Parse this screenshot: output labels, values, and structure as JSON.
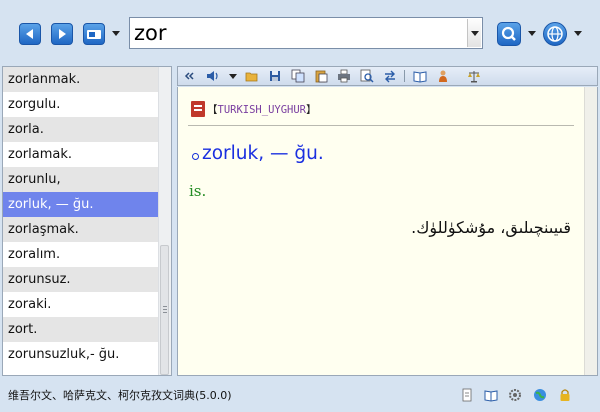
{
  "search": {
    "value": "zor"
  },
  "wordlist": {
    "items": [
      {
        "label": "zorlanmak.",
        "state": "shade"
      },
      {
        "label": "zorgulu.",
        "state": "plain"
      },
      {
        "label": "zorla.",
        "state": "shade"
      },
      {
        "label": "zorlamak.",
        "state": "plain"
      },
      {
        "label": "zorunlu,",
        "state": "shade"
      },
      {
        "label": "zorluk, — ğu.",
        "state": "selected"
      },
      {
        "label": "zorlaşmak.",
        "state": "shade"
      },
      {
        "label": "zoralım.",
        "state": "plain"
      },
      {
        "label": "zorunsuz.",
        "state": "shade"
      },
      {
        "label": "zoraki.",
        "state": "plain"
      },
      {
        "label": "zort.",
        "state": "shade"
      },
      {
        "label": "zorunsuzluk,- ğu.",
        "state": "plain"
      }
    ]
  },
  "entry": {
    "source_left_bracket": "【",
    "source_name": "TURKISH_UYGHUR",
    "source_right_bracket": "】",
    "headword": "zorluk, — ğu.",
    "part_of_speech": "is.",
    "definition": "قىيىنچىلىق، مۇشكۈللۈك."
  },
  "status": {
    "text": "维吾尔文、哈萨克文、柯尔克孜文词典(5.0.0)"
  },
  "colors": {
    "accent_blue": "#1f67c4",
    "selection": "#6f84ec",
    "headword": "#1a2fe0",
    "source_name": "#7a3fa0",
    "part_of_speech": "#228b22"
  },
  "icons": {
    "toolbar": [
      "back-icon",
      "forward-icon",
      "clipboard-icon",
      "search-icon",
      "globe-icon"
    ],
    "content_toolbar": [
      "collapse-icon",
      "speaker-icon",
      "open-folder-icon",
      "save-icon",
      "copy-icon",
      "paste-icon",
      "print-icon",
      "preview-icon",
      "swap-icon",
      "book-icon",
      "person-icon",
      "scale-icon"
    ],
    "status": [
      "document-icon",
      "book-icon",
      "settings-icon",
      "globe-icon",
      "lock-icon"
    ]
  }
}
